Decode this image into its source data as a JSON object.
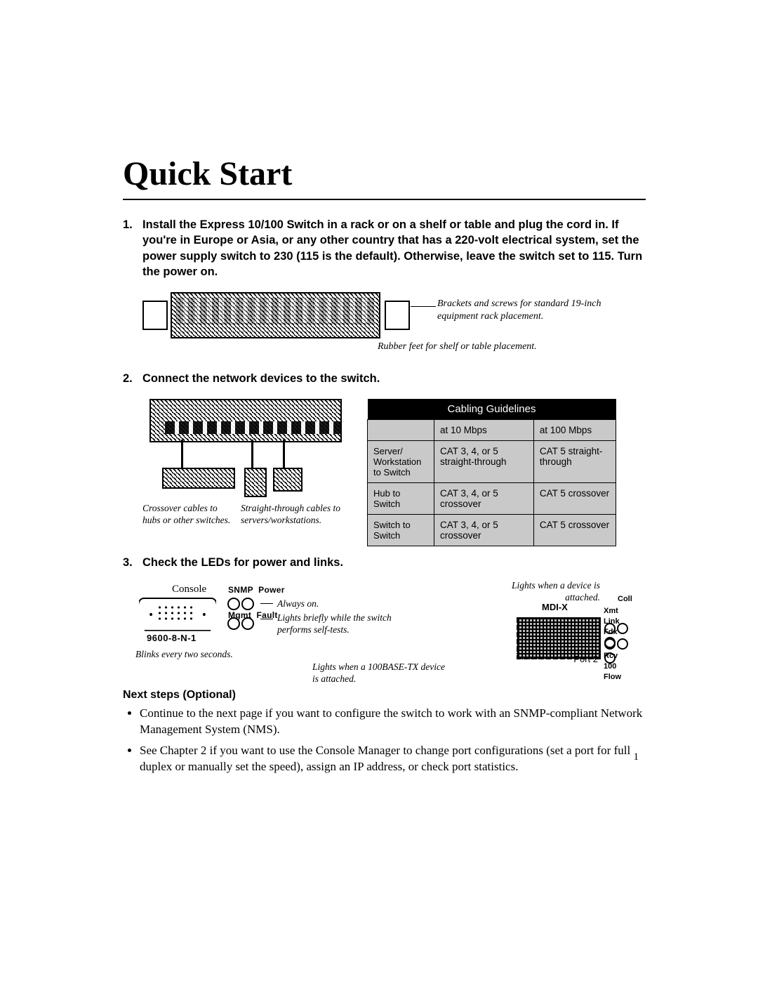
{
  "title": "Quick Start",
  "steps": {
    "s1": {
      "num": "1.",
      "text": "Install the Express 10/100 Switch in a rack or on a shelf or table and plug the cord in. If you're in Europe or Asia, or any other country that has a 220-volt electrical system, set the power supply switch to 230 (115 is the default). Otherwise, leave the switch set to 115. Turn the power on."
    },
    "s2": {
      "num": "2.",
      "text": "Connect the network devices to the switch."
    },
    "s3": {
      "num": "3.",
      "text": "Check the LEDs for power and links."
    }
  },
  "fig1": {
    "bracket_caption": "Brackets and screws for standard 19-inch equipment rack placement.",
    "feet_caption": "Rubber feet for shelf or table placement."
  },
  "fig2": {
    "crossover_caption": "Crossover cables to hubs or other switches.",
    "straight_caption": "Straight-through cables to servers/workstations."
  },
  "cabling": {
    "header": "Cabling Guidelines",
    "col10": "at 10 Mbps",
    "col100": "at 100 Mbps",
    "rows": [
      {
        "label": "Server/ Workstation to Switch",
        "c10": "CAT 3, 4, or 5 straight-through",
        "c100": "CAT 5 straight-through"
      },
      {
        "label": "Hub to Switch",
        "c10": "CAT 3, 4, or 5 crossover",
        "c100": "CAT 5 crossover"
      },
      {
        "label": "Switch to Switch",
        "c10": "CAT 3, 4, or 5 crossover",
        "c100": "CAT 5 crossover"
      }
    ]
  },
  "fig3": {
    "console_label": "Console",
    "model": "9600-8-N-1",
    "snmp": "SNMP",
    "power": "Power",
    "mgmt": "Mgmt",
    "fault": "Fault",
    "always_on": "Always on.",
    "selftests": "Lights briefly while the switch performs self-tests.",
    "blinks": "Blinks every two seconds.",
    "tx100": "Lights when a 100BASE-TX device is attached.",
    "attached": "Lights when a device is attached.",
    "mdix": "MDI-X",
    "coll": "Coll",
    "xmt": "Xmt",
    "link": "Link",
    "fdx": "Fdx",
    "rcv": "Rcv",
    "p100": "100",
    "flow": "Flow",
    "port2": "Port 2"
  },
  "next_steps": {
    "heading": "Next steps (Optional)",
    "b1": "Continue to the next page if you want to configure the switch to work with an SNMP-compliant Network Management System (NMS).",
    "b2": "See Chapter 2 if you want to use the Console Manager to change port configurations (set a port for full duplex or manually set the speed), assign an IP address, or check port statistics."
  },
  "page_number": "1"
}
